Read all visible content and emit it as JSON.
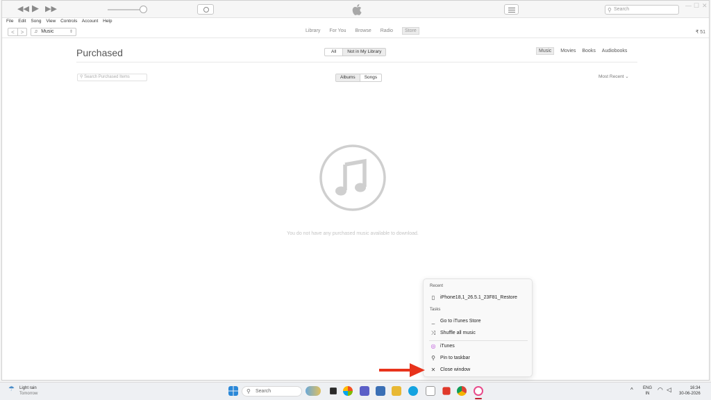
{
  "toolbar": {
    "rewind_icon": "rewind-icon",
    "play_icon": "play-icon",
    "forward_icon": "fast-forward-icon",
    "search_placeholder": "Search",
    "minimize_label": "—",
    "maximize_label": "☐",
    "close_label": "✕"
  },
  "menu": [
    "File",
    "Edit",
    "Song",
    "View",
    "Controls",
    "Account",
    "Help"
  ],
  "nav": {
    "back": "<",
    "forward": ">",
    "media_kind": "Music",
    "tabs": [
      "Library",
      "For You",
      "Browse",
      "Radio",
      "Store"
    ],
    "active_tab": "Store",
    "credit": "₹ 51"
  },
  "purchased": {
    "title": "Purchased",
    "filter_all": "All",
    "filter_not_in_library": "Not in My Library",
    "categories": [
      "Music",
      "Movies",
      "Books",
      "Audiobooks"
    ],
    "selected_category": "Music",
    "search_placeholder": "Search Purchased Items",
    "view_albums": "Albums",
    "view_songs": "Songs",
    "sort": "Most Recent ⌄",
    "empty_message": "You do not have any purchased music available to download."
  },
  "jumplist": {
    "recent_header": "Recent",
    "recent_item": "iPhone18,1_26.5.1_23F81_Restore",
    "tasks_header": "Tasks",
    "task_store": "Go to iTunes Store",
    "task_shuffle": "Shuffle all music",
    "app_name": "iTunes",
    "pin": "Pin to taskbar",
    "close": "Close window"
  },
  "taskbar": {
    "weather_title": "Light rain",
    "weather_sub": "Tomorrow",
    "search_label": "Search",
    "lang": "ENG",
    "region": "IN",
    "time": "16:34",
    "date": "30-06-2026"
  },
  "colors": {
    "accent_red": "#e8331c",
    "itunes_icon": "#c8c8c8"
  }
}
